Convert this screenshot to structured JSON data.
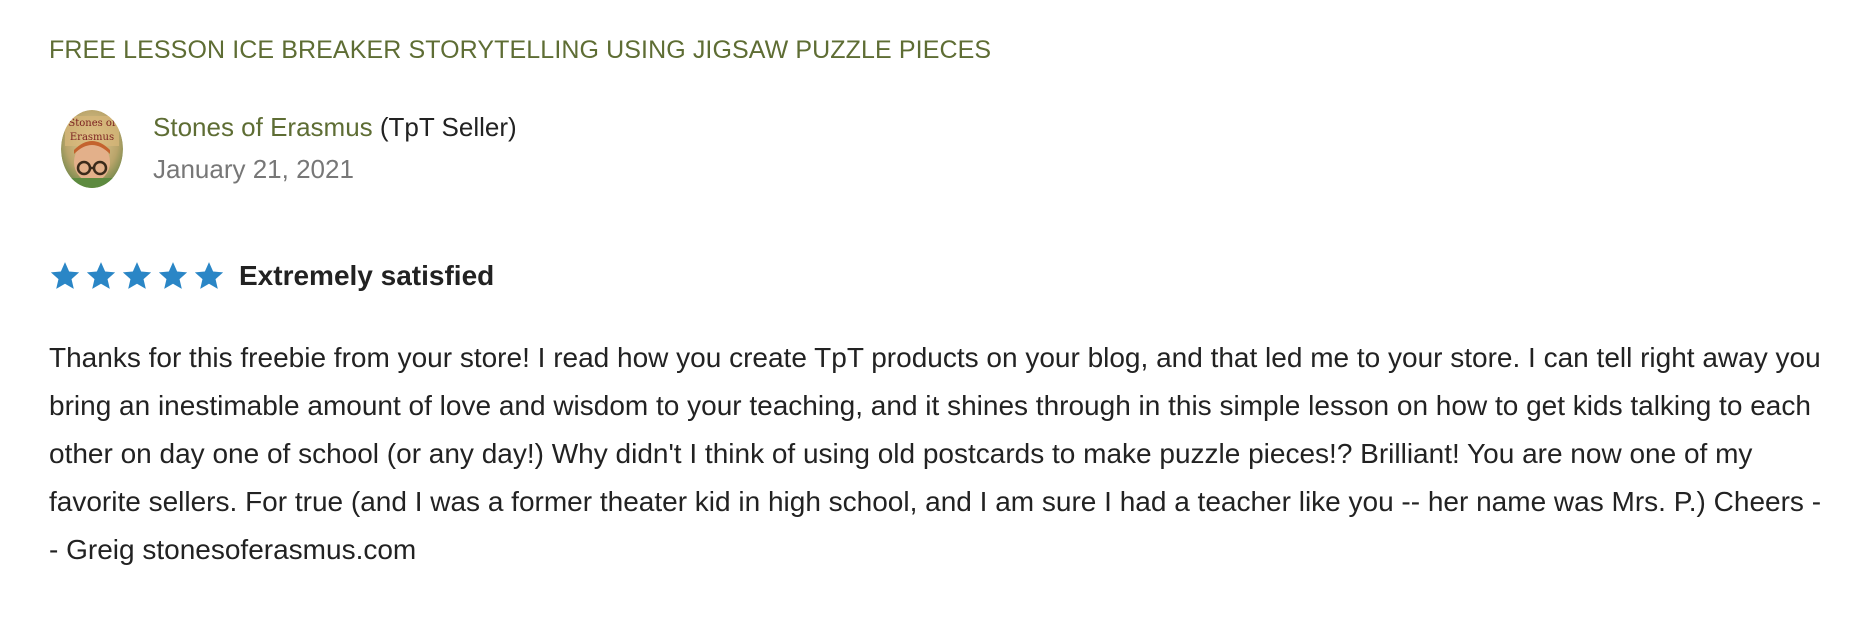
{
  "product": {
    "title": "FREE LESSON ICE BREAKER STORYTELLING USING JIGSAW PUZZLE PIECES"
  },
  "reviewer": {
    "avatar_icon": "store-logo-avatar",
    "avatar_text_line1": "Stones of",
    "avatar_text_line2": "Erasmus",
    "name": "Stones of Erasmus",
    "role": "(TpT Seller)",
    "date": "January 21, 2021"
  },
  "rating": {
    "stars": 5,
    "max_stars": 5,
    "star_icon": "star-icon",
    "star_color": "#2a86c6",
    "label": "Extremely satisfied"
  },
  "review": {
    "text": "Thanks for this freebie from your store! I read how you create TpT products on your blog, and that led me to your store. I can tell right away you bring an inestimable amount of love and wisdom to your teaching, and it shines through in this simple lesson on how to get kids talking to each other on day one of school (or any day!) Why didn't I think of using old postcards to make puzzle pieces!? Brilliant! You are now one of my favorite sellers. For true (and I was a former theater kid in high school, and I am sure I had a teacher like you -- her name was Mrs. P.) Cheers -- Greig stonesoferasmus.com"
  },
  "colors": {
    "link_green": "#5e6d34",
    "text_dark": "#222222",
    "text_muted": "#777777"
  }
}
